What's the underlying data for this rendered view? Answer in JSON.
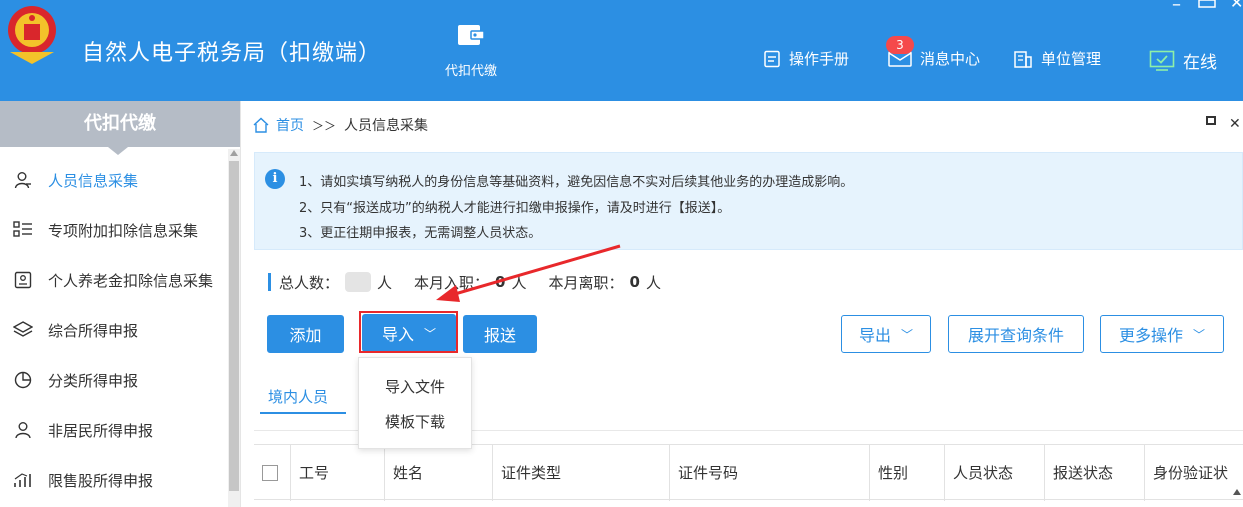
{
  "header": {
    "app_title": "自然人电子税务局（扣缴端）",
    "module": {
      "label": "代扣代缴",
      "icon": "wallet-icon"
    },
    "manual": {
      "label": "操作手册",
      "icon": "manual-icon"
    },
    "messages": {
      "label": "消息中心",
      "icon": "mail-icon",
      "badge": "3"
    },
    "unit": {
      "label": "单位管理",
      "icon": "building-icon"
    },
    "online": {
      "label": "在线",
      "icon": "monitor-check-icon"
    },
    "accent_color": "#2c8fe3"
  },
  "sidebar": {
    "title": "代扣代缴",
    "items": [
      {
        "label": "人员信息采集",
        "icon": "person-icon",
        "active": true
      },
      {
        "label": "专项附加扣除信息采集",
        "icon": "list-icon",
        "active": false
      },
      {
        "label": "个人养老金扣除信息采集",
        "icon": "pension-card-icon",
        "active": false
      },
      {
        "label": "综合所得申报",
        "icon": "layers-icon",
        "active": false
      },
      {
        "label": "分类所得申报",
        "icon": "pie-icon",
        "active": false
      },
      {
        "label": "非居民所得申报",
        "icon": "user-outline-icon",
        "active": false
      },
      {
        "label": "限售股所得申报",
        "icon": "signal-icon",
        "active": false
      }
    ]
  },
  "breadcrumb": {
    "home": "首页",
    "separator": "＞＞",
    "current": "人员信息采集"
  },
  "notice": {
    "lines": [
      "1、请如实填写纳税人的身份信息等基础资料，避免因信息不实对后续其他业务的办理造成影响。",
      "2、只有“报送成功”的纳税人才能进行扣缴申报操作，请及时进行【报送】。",
      "3、更正往期申报表，无需调整人员状态。"
    ]
  },
  "stats": {
    "total_label": "总人数：",
    "total_unit": "人",
    "joined_label": "本月入职：",
    "joined_value": "0",
    "joined_unit": "人",
    "left_label": "本月离职：",
    "left_value": "0",
    "left_unit": "人"
  },
  "toolbar": {
    "add": "添加",
    "import": "导入",
    "submit": "报送",
    "export": "导出",
    "expand_query": "展开查询条件",
    "more": "更多操作"
  },
  "import_menu": {
    "options": [
      "导入文件",
      "模板下载"
    ]
  },
  "subtabs": {
    "domestic": "境内人员"
  },
  "table": {
    "columns": [
      "工号",
      "姓名",
      "证件类型",
      "证件号码",
      "性别",
      "人员状态",
      "报送状态",
      "身份验证状"
    ]
  },
  "annotation_color": "#e8282b"
}
